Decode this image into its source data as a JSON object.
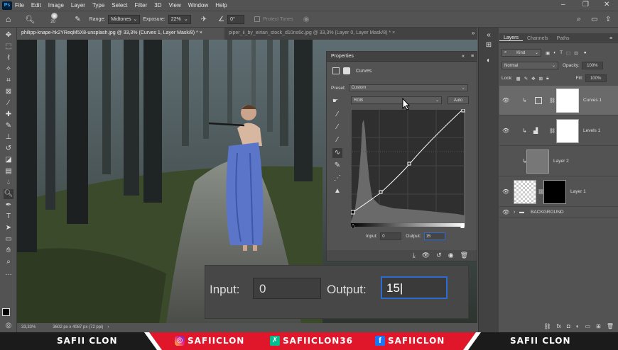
{
  "menu": [
    "File",
    "Edit",
    "Image",
    "Layer",
    "Type",
    "Select",
    "Filter",
    "3D",
    "View",
    "Window",
    "Help"
  ],
  "app_logo": "Ps",
  "window_controls": {
    "minimize": "–",
    "restore": "❐",
    "close": "✕"
  },
  "options": {
    "brush_size": "20",
    "range_label": "Range:",
    "range_value": "Midtones",
    "exposure_label": "Exposure:",
    "exposure_value": "22%",
    "angle_value": "0°",
    "protect_tones": "Protect Tones"
  },
  "tabs": [
    {
      "label": "philipp-knape-hk2YReqM5X8-unsplash.jpg @ 33,3% (Curves 1, Layer Mask/8) *",
      "close": "×"
    },
    {
      "label": "piper_ii_by_eirian_stock_d10ns6c.jpg @ 33,3% (Layer 0, Layer Mask/8) *",
      "close": "×"
    }
  ],
  "status": {
    "zoom": "33,33%",
    "doc_info": "3602 px x 4087 px (72 ppi)"
  },
  "properties": {
    "title": "Properties",
    "adjustment_name": "Curves",
    "preset_label": "Preset:",
    "preset_value": "Custom",
    "channel_value": "RGB",
    "auto_label": "Auto",
    "input_label": "Input:",
    "input_value": "0",
    "output_label": "Output:",
    "output_value": "15"
  },
  "zoom_overlay": {
    "input_label": "Input:",
    "input_value": "0",
    "output_label": "Output:",
    "output_value": "15"
  },
  "layers_panel": {
    "tabs": [
      "Layers",
      "Channels",
      "Paths"
    ],
    "filter_kind": "Kind",
    "blend_mode": "Normal",
    "opacity_label": "Opacity:",
    "opacity_value": "100%",
    "lock_label": "Lock:",
    "fill_label": "Fill:",
    "fill_value": "100%",
    "layers": [
      "Curves 1",
      "Levels 1",
      "Layer 2",
      "Layer 1",
      "BACKGROUND"
    ]
  },
  "banner": {
    "left_name": "SAFII CLON",
    "instagram": "SAFIICLON",
    "vine": "SAFIICLON36",
    "facebook": "SAFIICLON",
    "right_name": "SAFII CLON"
  },
  "colors": {
    "ui_bg": "#535353",
    "panel_dark": "#424242",
    "accent_red": "#e0162b",
    "curve_line": "#ffffff",
    "selection_blue": "#2d6bd3"
  }
}
